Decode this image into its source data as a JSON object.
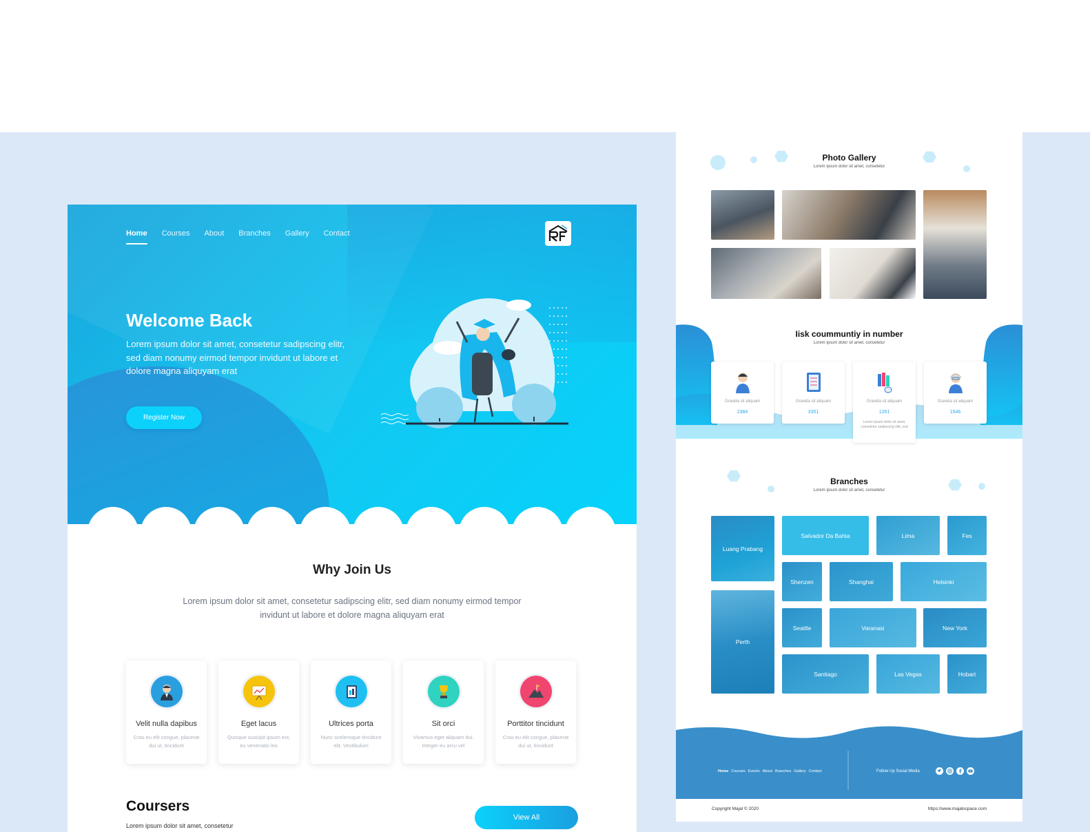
{
  "left_page": {
    "nav": [
      "Home",
      "Courses",
      "About",
      "Branches",
      "Gallery",
      "Contact"
    ],
    "hero": {
      "title": "Welcome Back",
      "text": "Lorem ipsum dolor sit amet, consetetur sadipscing elitr, sed diam nonumy eirmod tempor invidunt ut labore et dolore magna aliquyam erat",
      "cta": "Register Now"
    },
    "why": {
      "title": "Why Join Us",
      "text": "Lorem ipsum dolor sit amet, consetetur sadipscing elitr, sed diam nonumy eirmod tempor invidunt ut labore et dolore magna aliquyam erat",
      "features": [
        {
          "title": "Velit nulla dapibus",
          "desc": "Cras eu elit congue, placerat dui ut, tincidunt",
          "icon": "teacher-icon",
          "color": "#2a9fe0"
        },
        {
          "title": "Eget lacus",
          "desc": "Quisque suscipit ipsum est, eu venenatis leo",
          "icon": "presentation-board-icon",
          "color": "#f7c40d"
        },
        {
          "title": "Ultrices porta",
          "desc": "Nunc scelerisque tincidunt elit. Vestibulum",
          "icon": "book-icon",
          "color": "#1ec0f2"
        },
        {
          "title": "Sit orci",
          "desc": "Vivamus eget aliquam dui. Integer eu arcu vel",
          "icon": "trophy-icon",
          "color": "#2fd3c0"
        },
        {
          "title": "Porttitor tincidunt",
          "desc": "Cras eu elit congue, placerat dui ut, tincidunt",
          "icon": "mountain-flag-icon",
          "color": "#f0456f"
        }
      ]
    },
    "courses": {
      "title": "Coursers",
      "sub": "Lorem ipsum dolor sit amet, consetetur",
      "view_all": "View All"
    }
  },
  "right_page": {
    "gallery": {
      "title": "Photo Gallery",
      "sub": "Lorem ipsum dolor sit amet, consetetur"
    },
    "community": {
      "title": "Iisk coummuntiy in number",
      "sub": "Lorem ipsum dolor sit amet, consetetur",
      "stats": [
        {
          "label": "Gravida sit aliquam",
          "value": "2384",
          "icon": "student-icon"
        },
        {
          "label": "Gravida sit aliquam",
          "value": "3351",
          "icon": "notebook-icon"
        },
        {
          "label": "Gravida sit aliquam",
          "value": "1261",
          "icon": "books-mouse-icon",
          "extra": "Lorem ipsum dolor sit amet, consetetur sadipscing elitr, sed"
        },
        {
          "label": "Gravida sit aliquam",
          "value": "1546",
          "icon": "professor-icon"
        }
      ]
    },
    "branches": {
      "title": "Branches",
      "sub": "Lorem ipsum dolor sit amet, consetetur",
      "cities": [
        "Luang Prabang",
        "Salvador Da Bahia",
        "Lima",
        "Fes",
        "Shenzen",
        "Shanghai",
        "Helsinki",
        "Perth",
        "Seattle",
        "Varanasi",
        "New York",
        "Santiago",
        "Las Vegas",
        "Hobart"
      ]
    },
    "footer": {
      "nav": [
        "Home",
        "Courses",
        "Events",
        "About",
        "Branches",
        "Gallery",
        "Contact"
      ],
      "follow": "Follow Up Social Media",
      "social": [
        "twitter-icon",
        "instagram-icon",
        "facebook-icon",
        "youtube-icon"
      ],
      "copyright": "Copyright Majal ©  2020",
      "url": "https://www.majalscpace.com"
    }
  }
}
